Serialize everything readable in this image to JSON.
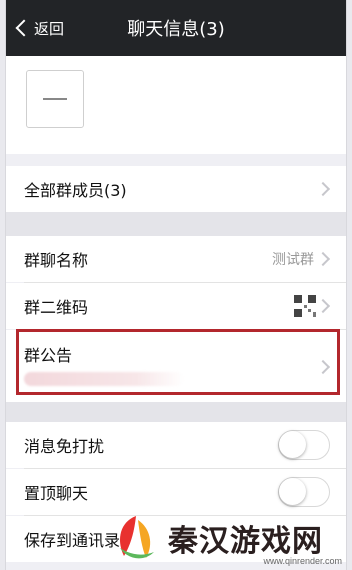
{
  "header": {
    "back_label": "返回",
    "title": "聊天信息(3)"
  },
  "members": {
    "label": "全部群成员(3)"
  },
  "group_settings": {
    "name_label": "群聊名称",
    "name_value": "测试群",
    "qr_label": "群二维码",
    "notice_label": "群公告"
  },
  "toggles": {
    "mute_label": "消息免打扰",
    "mute_on": false,
    "pin_label": "置顶聊天",
    "pin_on": false,
    "save_label": "保存到通讯录"
  },
  "watermark": {
    "text": "秦汉游戏网",
    "url": "www.qinrender.com"
  },
  "colors": {
    "topbar": "#222427",
    "highlight": "#b3272d",
    "background": "#efeff4"
  }
}
